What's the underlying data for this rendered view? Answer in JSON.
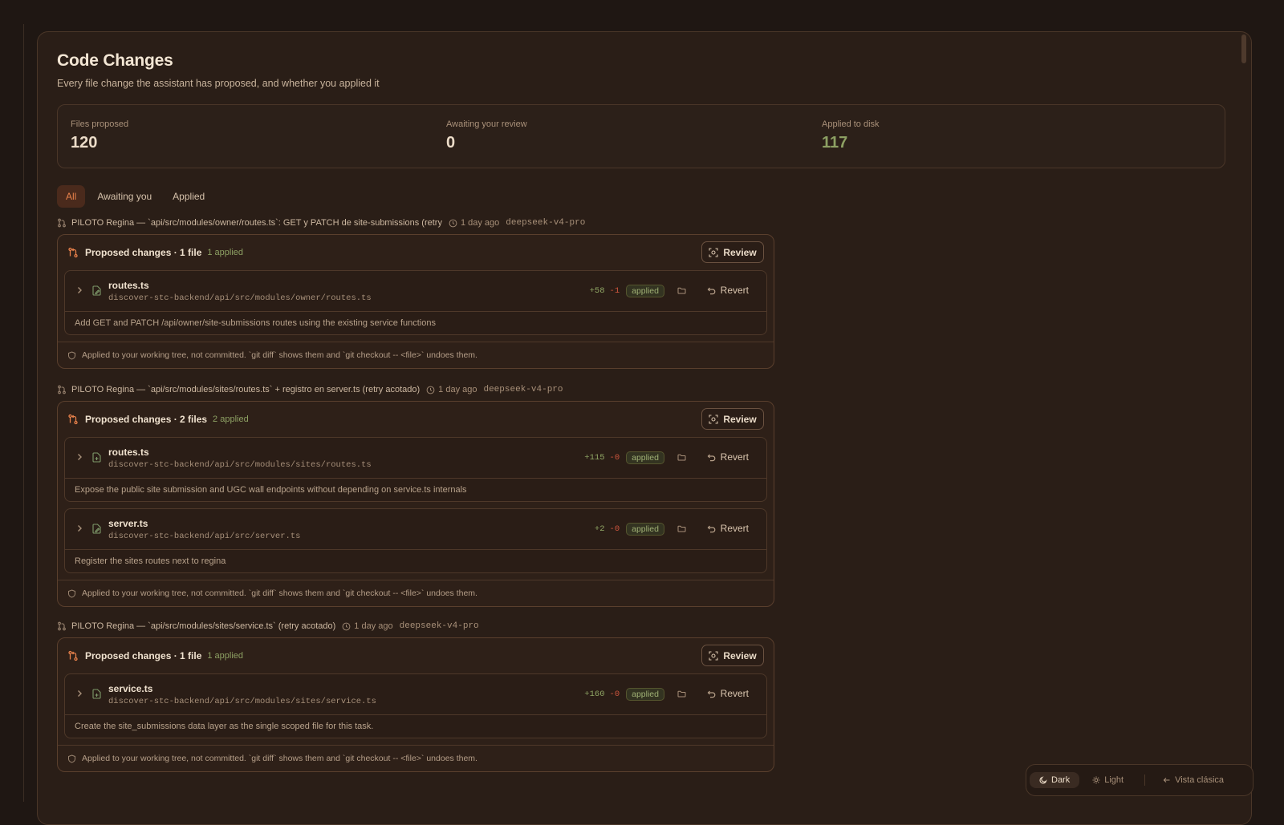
{
  "header": {
    "title": "Code Changes",
    "subtitle": "Every file change the assistant has proposed, and whether you applied it"
  },
  "stats": [
    {
      "label": "Files proposed",
      "value": "120"
    },
    {
      "label": "Awaiting your review",
      "value": "0"
    },
    {
      "label": "Applied to disk",
      "value": "117"
    }
  ],
  "tabs": [
    {
      "label": "All",
      "active": true
    },
    {
      "label": "Awaiting you",
      "active": false
    },
    {
      "label": "Applied",
      "active": false
    }
  ],
  "groups": [
    {
      "title": "PILOTO Regina — `api/src/modules/owner/routes.ts`: GET y PATCH de site-submissions (retry",
      "time": "1 day ago",
      "model": "deepseek-v4-pro",
      "card_title": "Proposed changes · 1 file",
      "card_applied": "1 applied",
      "review_label": "Review",
      "files": [
        {
          "name": "routes.ts",
          "path": "discover-stc-backend/api/src/modules/owner/routes.ts",
          "plus": "+58",
          "minus": "-1",
          "badge": "applied",
          "revert": "Revert",
          "desc": "Add GET and PATCH /api/owner/site-submissions routes using the existing service functions",
          "icon": "file-edit-icon"
        }
      ],
      "footer": "Applied to your working tree, not committed. `git diff` shows them and `git checkout -- <file>` undoes them."
    },
    {
      "title": "PILOTO Regina — `api/src/modules/sites/routes.ts` + registro en server.ts (retry acotado)",
      "time": "1 day ago",
      "model": "deepseek-v4-pro",
      "card_title": "Proposed changes · 2 files",
      "card_applied": "2 applied",
      "review_label": "Review",
      "files": [
        {
          "name": "routes.ts",
          "path": "discover-stc-backend/api/src/modules/sites/routes.ts",
          "plus": "+115",
          "minus": "-0",
          "badge": "applied",
          "revert": "Revert",
          "desc": "Expose the public site submission and UGC wall endpoints without depending on service.ts internals",
          "icon": "file-new-icon"
        },
        {
          "name": "server.ts",
          "path": "discover-stc-backend/api/src/server.ts",
          "plus": "+2",
          "minus": "-0",
          "badge": "applied",
          "revert": "Revert",
          "desc": "Register the sites routes next to regina",
          "icon": "file-edit-icon"
        }
      ],
      "footer": "Applied to your working tree, not committed. `git diff` shows them and `git checkout -- <file>` undoes them."
    },
    {
      "title": "PILOTO Regina — `api/src/modules/sites/service.ts` (retry acotado)",
      "time": "1 day ago",
      "model": "deepseek-v4-pro",
      "card_title": "Proposed changes · 1 file",
      "card_applied": "1 applied",
      "review_label": "Review",
      "files": [
        {
          "name": "service.ts",
          "path": "discover-stc-backend/api/src/modules/sites/service.ts",
          "plus": "+160",
          "minus": "-0",
          "badge": "applied",
          "revert": "Revert",
          "desc": "Create the site_submissions data layer as the single scoped file for this task.",
          "icon": "file-new-icon"
        }
      ],
      "footer": "Applied to your working tree, not committed. `git diff` shows them and `git checkout -- <file>` undoes them."
    }
  ],
  "theme_switcher": {
    "dark": "Dark",
    "light": "Light",
    "classic": "Vista clásica"
  },
  "colors": {
    "accent": "#e8814b",
    "applied_green": "#8da063",
    "deletion_red": "#d0563e",
    "background": "#1f1713"
  }
}
